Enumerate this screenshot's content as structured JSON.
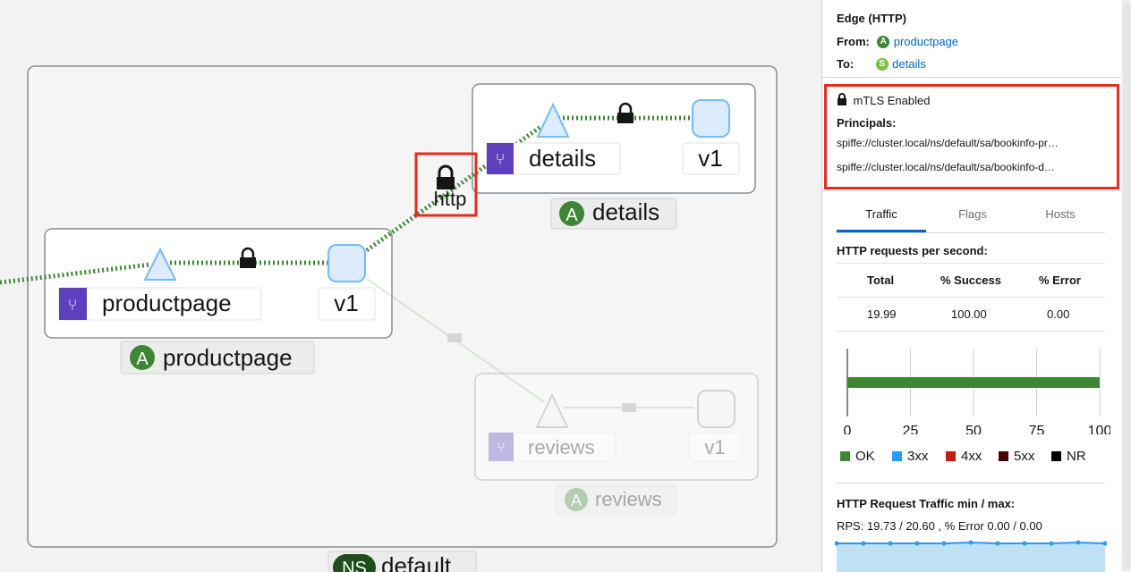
{
  "graph": {
    "namespace": {
      "badge": "NS",
      "name": "default"
    },
    "apps": [
      {
        "badge": "A",
        "name": "productpage"
      },
      {
        "badge": "A",
        "name": "details"
      },
      {
        "badge": "A",
        "name": "reviews"
      }
    ],
    "services": [
      "productpage",
      "details",
      "reviews"
    ],
    "versions": [
      "v1",
      "v1",
      "v1"
    ],
    "edge_label": "http"
  },
  "panel": {
    "title": "Edge (HTTP)",
    "from_label": "From:",
    "from_badge": "A",
    "from_value": "productpage",
    "to_label": "To:",
    "to_badge": "S",
    "to_value": "details",
    "mtls_label": "mTLS Enabled",
    "principals_label": "Principals:",
    "principals": [
      "spiffe://cluster.local/ns/default/sa/bookinfo-pr…",
      "spiffe://cluster.local/ns/default/sa/bookinfo-d…"
    ],
    "tabs": [
      "Traffic",
      "Flags",
      "Hosts"
    ],
    "active_tab": "Traffic",
    "rps_heading": "HTTP requests per second:",
    "table": {
      "headers": [
        "Total",
        "% Success",
        "% Error"
      ],
      "row": [
        "19.99",
        "100.00",
        "0.00"
      ]
    },
    "bar_ticks": [
      "0",
      "25",
      "50",
      "75",
      "100"
    ],
    "legend": [
      "OK",
      "3xx",
      "4xx",
      "5xx",
      "NR"
    ],
    "traffic_heading": "HTTP Request Traffic min / max:",
    "traffic_stats": "RPS: 19.73 / 20.60 , % Error 0.00 / 0.00"
  },
  "chart_data": {
    "type": "bar",
    "categories": [
      ""
    ],
    "series": [
      {
        "name": "OK",
        "values": [
          100
        ]
      },
      {
        "name": "3xx",
        "values": [
          0
        ]
      },
      {
        "name": "4xx",
        "values": [
          0
        ]
      },
      {
        "name": "5xx",
        "values": [
          0
        ]
      },
      {
        "name": "NR",
        "values": [
          0
        ]
      }
    ],
    "xlim": [
      0,
      100
    ],
    "ticks": [
      0,
      25,
      50,
      75,
      100
    ],
    "legend_position": "bottom",
    "colors": {
      "OK": "#3e8635",
      "3xx": "#2b9af3",
      "4xx": "#c9190b",
      "5xx": "#470000",
      "NR": "#000000"
    }
  },
  "colors": {
    "accent": "#0066cc",
    "edge": "#3e8635",
    "highlight": "#e32d1e",
    "service": "#5e40be"
  }
}
